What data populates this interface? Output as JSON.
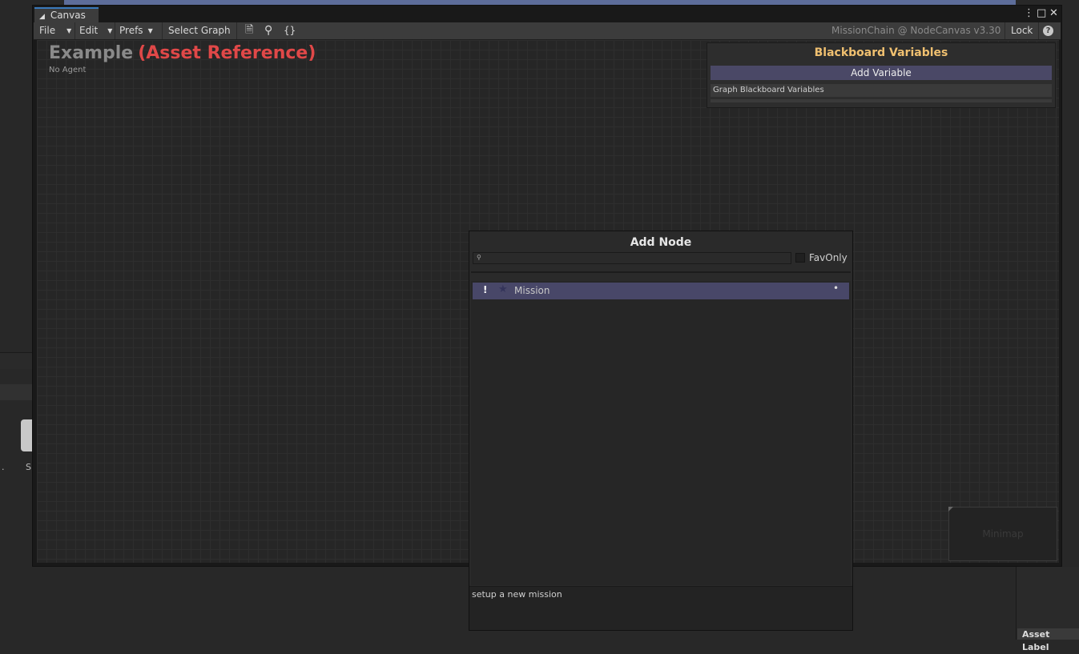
{
  "window": {
    "tab_title": "Canvas",
    "icons": {
      "tab": "graph-icon",
      "more": "kebab-menu-icon",
      "maximize": "maximize-icon",
      "close": "close-icon"
    }
  },
  "toolbar": {
    "file": "File",
    "edit": "Edit",
    "prefs": "Prefs",
    "select_graph": "Select Graph",
    "icons": [
      "document-icon",
      "search-icon",
      "braces-icon"
    ],
    "braces": "{}",
    "version": "MissionChain @ NodeCanvas v3.30",
    "lock": "Lock",
    "help": "?"
  },
  "canvas": {
    "graph_name": "Example",
    "asset_reference": "(Asset Reference)",
    "agent": "No Agent"
  },
  "blackboard": {
    "title": "Blackboard Variables",
    "add_variable": "Add Variable",
    "graph_variables": "Graph Blackboard Variables"
  },
  "minimap": {
    "label": "Minimap"
  },
  "add_node": {
    "title": "Add Node",
    "search_placeholder": "",
    "fav_only": "FavOnly",
    "items": [
      {
        "label": "Mission",
        "warning": "!",
        "favorite": false
      }
    ],
    "description": "setup a new mission"
  },
  "editor": {
    "left_panel_text": "S",
    "left_panel_text2": ".",
    "asset_label": "Asset Label"
  }
}
